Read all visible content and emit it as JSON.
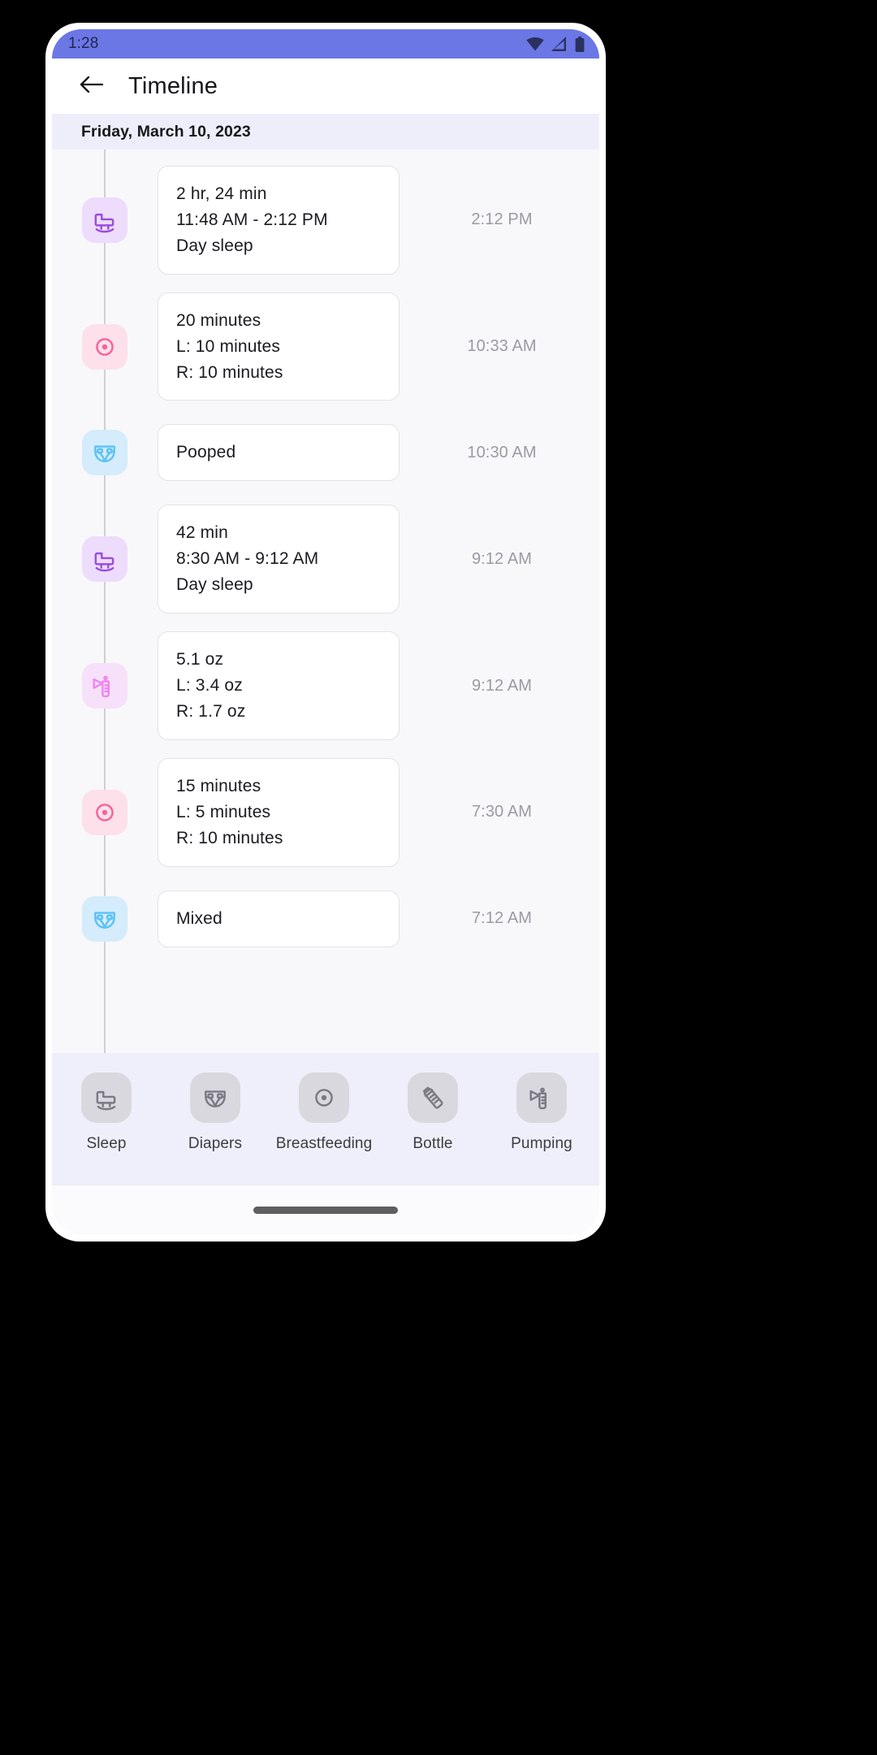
{
  "status_bar": {
    "time": "1:28",
    "icons": [
      "wifi-icon",
      "cell-signal-icon",
      "battery-icon"
    ],
    "background_color": "#6b77e5"
  },
  "app_bar": {
    "back_icon": "arrow-left-icon",
    "title": "Timeline"
  },
  "date_header": {
    "label": "Friday, March 10, 2023",
    "background_color": "#eeeefb"
  },
  "timeline": {
    "entries": [
      {
        "icon": "sleep-crib-icon",
        "icon_color": "#9b4ddb",
        "icon_bg": "#eddcfb",
        "lines": [
          "2 hr, 24 min",
          "11:48 AM - 2:12 PM",
          "Day sleep"
        ],
        "time": "2:12 PM"
      },
      {
        "icon": "breastfeeding-icon",
        "icon_color": "#f5629a",
        "icon_bg": "#fde0ea",
        "lines": [
          "20 minutes",
          "L: 10 minutes",
          "R: 10 minutes"
        ],
        "time": "10:33 AM"
      },
      {
        "icon": "diaper-icon",
        "icon_color": "#5cc2f5",
        "icon_bg": "#d4ecfb",
        "lines": [
          "Pooped"
        ],
        "time": "10:30 AM"
      },
      {
        "icon": "sleep-crib-icon",
        "icon_color": "#9b4ddb",
        "icon_bg": "#eddcfb",
        "lines": [
          "42 min",
          "8:30 AM - 9:12 AM",
          "Day sleep"
        ],
        "time": "9:12 AM"
      },
      {
        "icon": "pumping-icon",
        "icon_color": "#ef86ef",
        "icon_bg": "#f7e0f9",
        "lines": [
          "5.1 oz",
          "L: 3.4 oz",
          "R: 1.7 oz"
        ],
        "time": "9:12 AM"
      },
      {
        "icon": "breastfeeding-icon",
        "icon_color": "#f5629a",
        "icon_bg": "#fde0ea",
        "lines": [
          "15 minutes",
          "L: 5 minutes",
          "R: 10 minutes"
        ],
        "time": "7:30 AM"
      },
      {
        "icon": "diaper-icon",
        "icon_color": "#5cc2f5",
        "icon_bg": "#d4ecfb",
        "lines": [
          "Mixed"
        ],
        "time": "7:12 AM"
      }
    ]
  },
  "bottom_nav": {
    "items": [
      {
        "label": "Sleep",
        "icon": "sleep-crib-icon"
      },
      {
        "label": "Diapers",
        "icon": "diaper-icon"
      },
      {
        "label": "Breastfeeding",
        "icon": "breastfeeding-icon"
      },
      {
        "label": "Bottle",
        "icon": "bottle-icon"
      },
      {
        "label": "Pumping",
        "icon": "pumping-icon"
      }
    ]
  }
}
